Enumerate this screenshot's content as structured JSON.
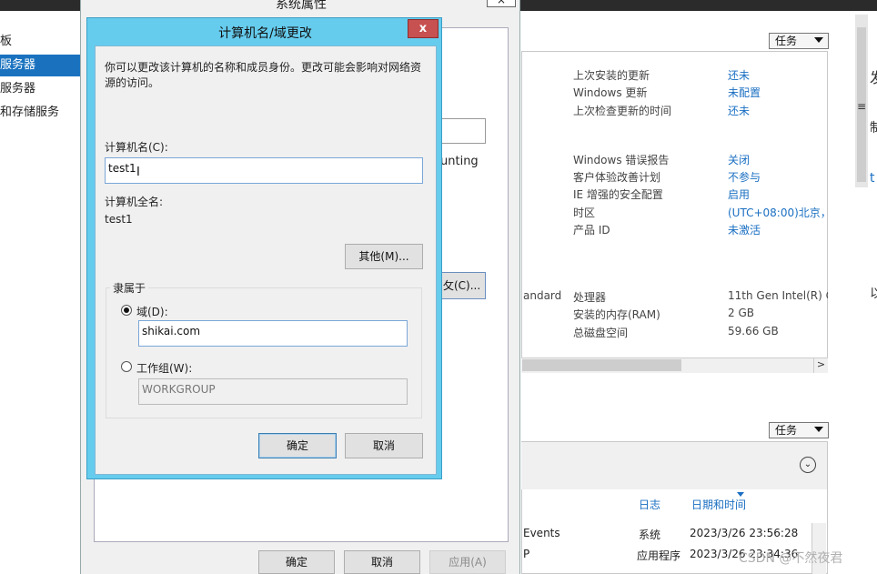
{
  "leftnav": {
    "items": [
      {
        "label": "板",
        "selected": false
      },
      {
        "label": "服务器",
        "selected": true
      },
      {
        "label": "服务器",
        "selected": false
      },
      {
        "label": "和存储服务",
        "selected": false
      }
    ]
  },
  "sysprops": {
    "title": "系统属性",
    "close_label": "×",
    "accounting_text": "unting",
    "change_button": "攵(C)...",
    "ok": "确定",
    "cancel": "取消",
    "apply": "应用(A)"
  },
  "server_manager": {
    "tasks_label": "任务",
    "properties": [
      {
        "label": "上次安装的更新",
        "value": "还未"
      },
      {
        "label": "Windows 更新",
        "value": "未配置"
      },
      {
        "label": "上次检查更新的时间",
        "value": "还未"
      },
      {
        "label": "Windows 错误报告",
        "value": "关闭"
      },
      {
        "label": "客户体验改善计划",
        "value": "不参与"
      },
      {
        "label": "IE 增强的安全配置",
        "value": "启用"
      },
      {
        "label": "时区",
        "value": "(UTC+08:00)北京，"
      },
      {
        "label": "产品 ID",
        "value": "未激活"
      },
      {
        "label": "处理器",
        "value": "11th Gen Intel(R) C"
      },
      {
        "label": "安装的内存(RAM)",
        "value": "2 GB"
      },
      {
        "label": "总磁盘空间",
        "value": "59.66 GB"
      }
    ],
    "standard_text": "andard",
    "events": {
      "columns": [
        "日志",
        "日期和时间"
      ],
      "rows": [
        {
          "name": "Events",
          "log": "系统",
          "time": "2023/3/26 23:56:28"
        },
        {
          "name": "P",
          "log": "应用程序",
          "time": "2023/3/26 23:34:36"
        }
      ]
    },
    "side_glyphs": [
      "发",
      "≡",
      "制",
      "t",
      "以"
    ]
  },
  "dialog": {
    "title": "计算机名/域更改",
    "close_label": "x",
    "intro": "你可以更改该计算机的名称和成员身份。更改可能会影响对网络资源的访问。",
    "computer_name_label": "计算机名(C):",
    "computer_name_value": "test1",
    "full_name_label": "计算机全名:",
    "full_name_value": "test1",
    "more_button": "其他(M)...",
    "member_of_label": "隶属于",
    "domain_label": "域(D):",
    "domain_value": "shikai.com",
    "domain_selected": true,
    "workgroup_label": "工作组(W):",
    "workgroup_value": "WORKGROUP",
    "ok": "确定",
    "cancel": "取消"
  },
  "watermark": "CSDN @不然夜君"
}
